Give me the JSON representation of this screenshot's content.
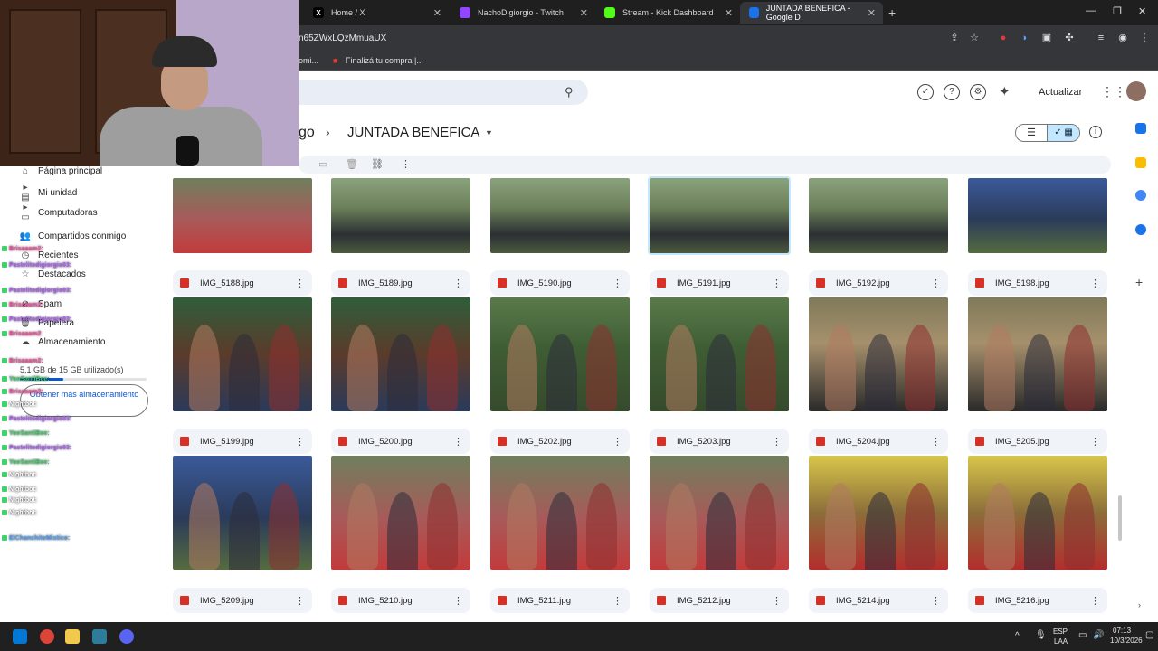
{
  "browser": {
    "tabs": [
      {
        "label": "Home / X",
        "icon": "x-logo-icon",
        "color": "#000000"
      },
      {
        "label": "NachoDigiorgio - Twitch",
        "icon": "twitch-icon",
        "color": "#9146ff"
      },
      {
        "label": "Stream - Kick Dashboard",
        "icon": "kick-icon",
        "color": "#53fc18"
      },
      {
        "label": "JUNTADA BENEFICA - Google D",
        "icon": "google-drive-icon",
        "color": "#1a73e8"
      }
    ],
    "url": "n65ZWxLQzMmuaUX",
    "bookmarks": [
      {
        "label": "omi..."
      },
      {
        "label": "Finalizá tu compra |..."
      }
    ]
  },
  "drive": {
    "update_label": "Actualizar",
    "breadcrumb": {
      "previous": "go",
      "separator": "›",
      "current": "JUNTADA BENEFICA"
    },
    "sidebar": {
      "items": [
        {
          "label": "Página principal",
          "icon": "home-icon"
        },
        {
          "label": "Mi unidad",
          "icon": "drive-icon"
        },
        {
          "label": "Computadoras",
          "icon": "computer-icon"
        },
        {
          "label": "Compartidos conmigo",
          "icon": "shared-icon"
        },
        {
          "label": "Recientes",
          "icon": "clock-icon"
        },
        {
          "label": "Destacados",
          "icon": "star-icon"
        },
        {
          "label": "Spam",
          "icon": "spam-icon"
        },
        {
          "label": "Papelera",
          "icon": "trash-icon"
        },
        {
          "label": "Almacenamiento",
          "icon": "cloud-icon"
        }
      ],
      "storage_text": "5,1 GB de 15 GB utilizado(s)",
      "storage_button": "Obtener más almacenamiento"
    },
    "files_row_top": [
      {
        "name": "",
        "thumb": "t-red"
      },
      {
        "name": "",
        "thumb": "t-crowd"
      },
      {
        "name": "",
        "thumb": "t-crowd"
      },
      {
        "name": "",
        "thumb": "t-crowd"
      },
      {
        "name": "",
        "thumb": "t-crowd"
      },
      {
        "name": "",
        "thumb": "t-blue"
      }
    ],
    "files_row_1": [
      {
        "name": "IMG_5188.jpg",
        "thumb": "t-ppl"
      },
      {
        "name": "IMG_5189.jpg",
        "thumb": "t-ppl"
      },
      {
        "name": "IMG_5190.jpg",
        "thumb": "t-grass"
      },
      {
        "name": "IMG_5191.jpg",
        "thumb": "t-grass"
      },
      {
        "name": "IMG_5192.jpg",
        "thumb": "t-women"
      },
      {
        "name": "IMG_5198.jpg",
        "thumb": "t-women"
      }
    ],
    "files_row_2": [
      {
        "name": "IMG_5199.jpg",
        "thumb": "t-blue"
      },
      {
        "name": "IMG_5200.jpg",
        "thumb": "t-red"
      },
      {
        "name": "IMG_5202.jpg",
        "thumb": "t-red"
      },
      {
        "name": "IMG_5203.jpg",
        "thumb": "t-red"
      },
      {
        "name": "IMG_5204.jpg",
        "thumb": "t-bright"
      },
      {
        "name": "IMG_5205.jpg",
        "thumb": "t-bright"
      }
    ],
    "files_row_3": [
      {
        "name": "IMG_5209.jpg"
      },
      {
        "name": "IMG_5210.jpg"
      },
      {
        "name": "IMG_5211.jpg"
      },
      {
        "name": "IMG_5212.jpg"
      },
      {
        "name": "IMG_5214.jpg"
      },
      {
        "name": "IMG_5216.jpg"
      }
    ]
  },
  "chat": {
    "lines": [
      {
        "user": "Brisaaam2:",
        "color": "#ff4fa3"
      },
      {
        "user": "Pastelitodigiorgio03:",
        "color": "#b05cff"
      },
      {
        "user": "Pastelitodigiorgio03:",
        "color": "#b05cff"
      },
      {
        "user": "Brisaaam2:",
        "color": "#ff4fa3"
      },
      {
        "user": "Pastelitodigiorgio03:",
        "color": "#b05cff"
      },
      {
        "user": "Brisaaam2",
        "color": "#ff4fa3"
      },
      {
        "user": "Brisaaam2:",
        "color": "#ff4fa3"
      },
      {
        "user": "YoeSantiBee:",
        "color": "#3fd26b"
      },
      {
        "user": "Brisaaam2:",
        "color": "#ff4fa3"
      },
      {
        "user": "Nightbot:",
        "color": "#ffffff"
      },
      {
        "user": "Pastelitodigiorgio03:",
        "color": "#b05cff"
      },
      {
        "user": "YoeSantiBee:",
        "color": "#3fd26b"
      },
      {
        "user": "Pastelitodigiorgio03:",
        "color": "#b05cff"
      },
      {
        "user": "YoeSantiBee:",
        "color": "#3fd26b"
      },
      {
        "user": "Nightbot:",
        "color": "#ffffff"
      },
      {
        "user": "Nightbot:",
        "color": "#ffffff"
      },
      {
        "user": "Nightbot:",
        "color": "#ffffff"
      },
      {
        "user": "Nightbot:",
        "color": "#ffffff"
      },
      {
        "user": "ElChanchitoMistico:",
        "color": "#4ea4ff"
      }
    ]
  },
  "taskbar": {
    "language": "ESP",
    "region": "LAA",
    "time": "07:13",
    "date": "10/3/2026"
  },
  "colors": {
    "accent": "#0b57d0",
    "toggle_active": "#c2e7ff",
    "card_bg": "#f0f4f9",
    "chrome_dark": "#35363a"
  }
}
